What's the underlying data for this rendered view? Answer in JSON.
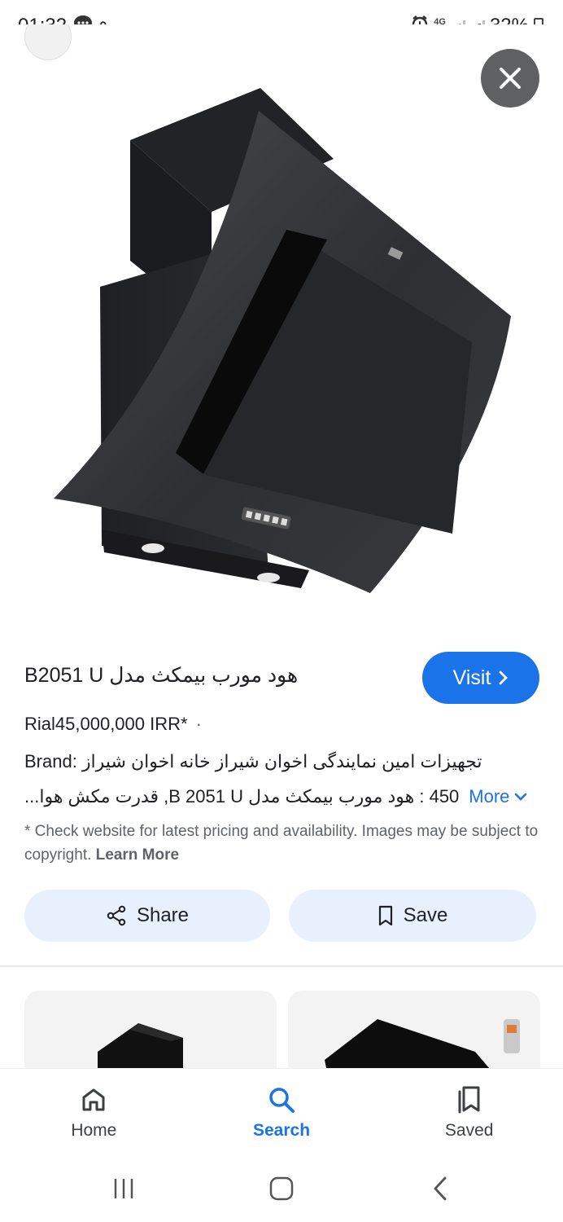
{
  "status_bar": {
    "time": "01:32",
    "extra_indicator": "۹",
    "network": "4G",
    "battery": "32%"
  },
  "product": {
    "title": "هود مورب بیمکث مدل B2051 U",
    "visit_label": "Visit",
    "price": "Rial45,000,000 IRR*",
    "description_line1": "Brand: تجهیزات امین نمایندگی اخوان شیراز خانه اخوان شیراز",
    "description_line2": "450 : هود مورب بیمکث مدل B 2051 U, قدرت مکش هوا...",
    "more_label": "More",
    "disclaimer": "* Check website for latest pricing and availability. Images may be subject to copyright.",
    "learn_more": "Learn More"
  },
  "actions": {
    "share_label": "Share",
    "save_label": "Save"
  },
  "bottom_nav": {
    "items": [
      {
        "label": "Home",
        "icon": "home-icon",
        "active": false
      },
      {
        "label": "Search",
        "icon": "search-icon",
        "active": true
      },
      {
        "label": "Saved",
        "icon": "saved-icon",
        "active": false
      }
    ]
  },
  "colors": {
    "accent": "#1a73e8",
    "pill_background": "#e8f0fe",
    "close_button": "#5f6062"
  }
}
